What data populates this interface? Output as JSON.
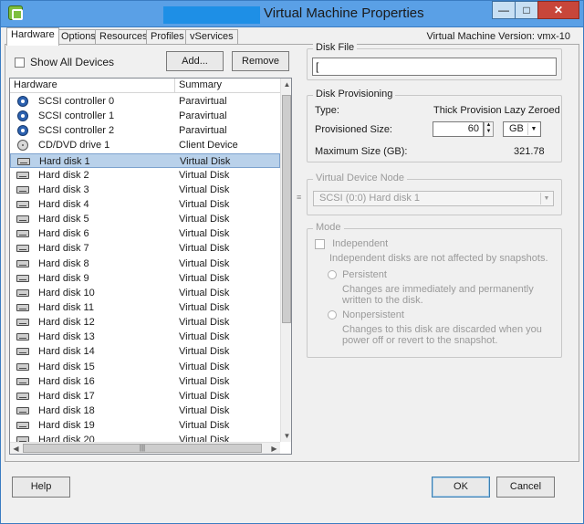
{
  "window": {
    "title": "Virtual Machine Properties",
    "controls": {
      "minimize": "—",
      "maximize": "□",
      "close": "✕"
    }
  },
  "tabs": [
    {
      "label": "Hardware",
      "active": true
    },
    {
      "label": "Options"
    },
    {
      "label": "Resources"
    },
    {
      "label": "Profiles"
    },
    {
      "label": "vServices"
    }
  ],
  "vm_version": "Virtual Machine Version: vmx-10",
  "toolbar": {
    "show_all_devices": "Show All Devices",
    "add_label": "Add...",
    "remove_label": "Remove"
  },
  "hardware_list": {
    "columns": [
      "Hardware",
      "Summary"
    ],
    "rows": [
      {
        "name": "SCSI controller 0",
        "summary": "Paravirtual",
        "icon": "scsi-controller-icon"
      },
      {
        "name": "SCSI controller 1",
        "summary": "Paravirtual",
        "icon": "scsi-controller-icon"
      },
      {
        "name": "SCSI controller 2",
        "summary": "Paravirtual",
        "icon": "scsi-controller-icon"
      },
      {
        "name": "CD/DVD drive 1",
        "summary": "Client Device",
        "icon": "cd-dvd-icon"
      },
      {
        "name": "Hard disk 1",
        "summary": "Virtual Disk",
        "icon": "hard-disk-icon",
        "selected": true
      },
      {
        "name": "Hard disk 2",
        "summary": "Virtual Disk",
        "icon": "hard-disk-icon"
      },
      {
        "name": "Hard disk 3",
        "summary": "Virtual Disk",
        "icon": "hard-disk-icon"
      },
      {
        "name": "Hard disk 4",
        "summary": "Virtual Disk",
        "icon": "hard-disk-icon"
      },
      {
        "name": "Hard disk 5",
        "summary": "Virtual Disk",
        "icon": "hard-disk-icon"
      },
      {
        "name": "Hard disk 6",
        "summary": "Virtual Disk",
        "icon": "hard-disk-icon"
      },
      {
        "name": "Hard disk 7",
        "summary": "Virtual Disk",
        "icon": "hard-disk-icon"
      },
      {
        "name": "Hard disk 8",
        "summary": "Virtual Disk",
        "icon": "hard-disk-icon"
      },
      {
        "name": "Hard disk 9",
        "summary": "Virtual Disk",
        "icon": "hard-disk-icon"
      },
      {
        "name": "Hard disk 10",
        "summary": "Virtual Disk",
        "icon": "hard-disk-icon"
      },
      {
        "name": "Hard disk 11",
        "summary": "Virtual Disk",
        "icon": "hard-disk-icon"
      },
      {
        "name": "Hard disk 12",
        "summary": "Virtual Disk",
        "icon": "hard-disk-icon"
      },
      {
        "name": "Hard disk 13",
        "summary": "Virtual Disk",
        "icon": "hard-disk-icon"
      },
      {
        "name": "Hard disk 14",
        "summary": "Virtual Disk",
        "icon": "hard-disk-icon"
      },
      {
        "name": "Hard disk 15",
        "summary": "Virtual Disk",
        "icon": "hard-disk-icon"
      },
      {
        "name": "Hard disk 16",
        "summary": "Virtual Disk",
        "icon": "hard-disk-icon"
      },
      {
        "name": "Hard disk 17",
        "summary": "Virtual Disk",
        "icon": "hard-disk-icon"
      },
      {
        "name": "Hard disk 18",
        "summary": "Virtual Disk",
        "icon": "hard-disk-icon"
      },
      {
        "name": "Hard disk 19",
        "summary": "Virtual Disk",
        "icon": "hard-disk-icon"
      },
      {
        "name": "Hard disk 20",
        "summary": "Virtual Disk",
        "icon": "hard-disk-icon"
      }
    ]
  },
  "disk_file": {
    "label": "Disk File",
    "value": "["
  },
  "disk_provisioning": {
    "label": "Disk Provisioning",
    "type_label": "Type:",
    "type_value": "Thick Provision Lazy Zeroed",
    "provisioned_size_label": "Provisioned Size:",
    "provisioned_size_value": "60",
    "unit": "GB",
    "max_size_label": "Maximum Size (GB):",
    "max_size_value": "321.78"
  },
  "virtual_device_node": {
    "label": "Virtual Device Node",
    "value": "SCSI (0:0) Hard disk 1"
  },
  "mode": {
    "label": "Mode",
    "independent_label": "Independent",
    "independent_desc": "Independent disks are not affected by snapshots.",
    "persistent_label": "Persistent",
    "persistent_desc": "Changes are immediately and permanently written to the disk.",
    "nonpersistent_label": "Nonpersistent",
    "nonpersistent_desc": "Changes to this disk are discarded when you power off or revert to the snapshot."
  },
  "footer": {
    "help": "Help",
    "ok": "OK",
    "cancel": "Cancel"
  }
}
